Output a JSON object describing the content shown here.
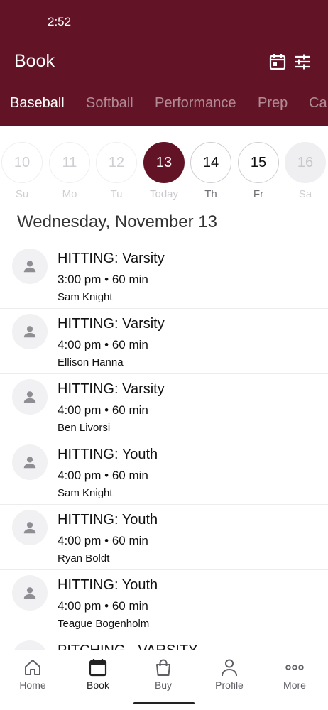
{
  "status": {
    "time": "2:52"
  },
  "header": {
    "title": "Book"
  },
  "tabs": [
    "Baseball",
    "Softball",
    "Performance",
    "Prep",
    "Ca"
  ],
  "days": [
    {
      "num": "10",
      "label": "Su"
    },
    {
      "num": "11",
      "label": "Mo"
    },
    {
      "num": "12",
      "label": "Tu"
    },
    {
      "num": "13",
      "label": "Today"
    },
    {
      "num": "14",
      "label": "Th"
    },
    {
      "num": "15",
      "label": "Fr"
    },
    {
      "num": "16",
      "label": "Sa"
    }
  ],
  "selected_date": "Wednesday, November 13",
  "sessions": [
    {
      "name": "HITTING: Varsity",
      "time": "3:00 pm • 60 min",
      "coach": "Sam Knight"
    },
    {
      "name": "HITTING: Varsity",
      "time": "4:00 pm • 60 min",
      "coach": "Ellison Hanna"
    },
    {
      "name": "HITTING: Varsity",
      "time": "4:00 pm • 60 min",
      "coach": "Ben Livorsi"
    },
    {
      "name": "HITTING: Youth",
      "time": "4:00 pm • 60 min",
      "coach": "Sam Knight"
    },
    {
      "name": "HITTING: Youth",
      "time": "4:00 pm • 60 min",
      "coach": "Ryan Boldt"
    },
    {
      "name": "HITTING: Youth",
      "time": "4:00 pm • 60 min",
      "coach": "Teague Bogenholm"
    },
    {
      "name": "PITCHING - VARSITY",
      "time": "",
      "coach": ""
    }
  ],
  "nav": [
    "Home",
    "Book",
    "Buy",
    "Profile",
    "More"
  ],
  "colors": {
    "brand": "#621426"
  }
}
